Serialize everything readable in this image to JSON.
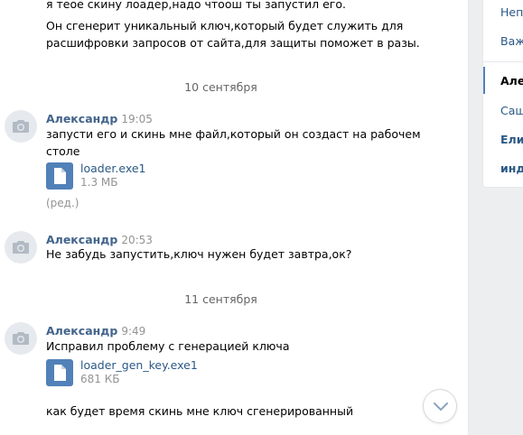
{
  "messages_top": {
    "line1": "я теое скину лоадер,надо чтоош ты запустил его.",
    "line2": "Он сгенерит уникальный ключ,который будет служить для",
    "line3": "расшифровки запросов от сайта,для защиты поможет в разы."
  },
  "dates": {
    "d1": "10 сентября",
    "d2": "11 сентября"
  },
  "msg1": {
    "author": "Александр",
    "time": "19:05",
    "line1": "запусти его и скинь мне файл,который он создаст на рабочем",
    "line2": "столе",
    "file_name": "loader.exe1",
    "file_size": "1.3 МБ",
    "edited": "(ред.)"
  },
  "msg2": {
    "author": "Александр",
    "time": "20:53",
    "line1": "Не забудь запустить,ключ нужен будет завтра,ок?"
  },
  "msg3": {
    "author": "Александр",
    "time": "9:49",
    "line1": "Исправил проблему с генерацией ключа",
    "file_name": "loader_gen_key.exe1",
    "file_size": "681 КБ",
    "line2": "как будет время скинь мне ключ сгенерированный"
  },
  "right_menu": {
    "items": [
      "Непр",
      "Важ",
      "Алек",
      "Саш",
      "Елис",
      "инд"
    ]
  },
  "colors": {
    "accent": "#5181b8",
    "author": "#42648b",
    "link": "#2a5885",
    "muted": "#939393"
  }
}
